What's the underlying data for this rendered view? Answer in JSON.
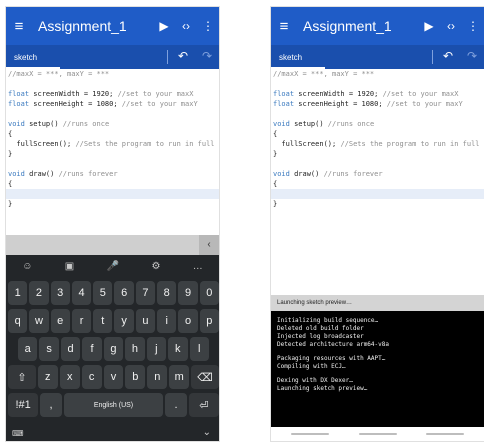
{
  "left": {
    "app_title": "Assignment_1",
    "menu_icon": "menu-icon",
    "play_icon": "play-icon",
    "code_icon": "code-icon",
    "more_icon": "more-vert-icon",
    "tab_label": "sketch",
    "undo_icon": "undo-icon",
    "redo_icon": "redo-icon",
    "code_lines": [
      "//maxX = ***, maxY = ***",
      "",
      "float screenWidth = 1920; //set to your maxX",
      "float screenHeight = 1080; //set to your maxY",
      "",
      "void setup() //runs once",
      "{",
      "  fullScreen(); //Sets the program to run in full",
      "}",
      "",
      "void draw() //runs forever",
      "{",
      "",
      "}"
    ],
    "keyboard": {
      "collapse_glyph": "‹",
      "tools": [
        "☺",
        "▣",
        "🎤",
        "⚙",
        "…"
      ],
      "number_row": [
        "1",
        "2",
        "3",
        "4",
        "5",
        "6",
        "7",
        "8",
        "9",
        "0"
      ],
      "row1": [
        "q",
        "w",
        "e",
        "r",
        "t",
        "y",
        "u",
        "i",
        "o",
        "p"
      ],
      "row2": [
        "a",
        "s",
        "d",
        "f",
        "g",
        "h",
        "j",
        "k",
        "l"
      ],
      "row3": [
        "⇧",
        "z",
        "x",
        "c",
        "v",
        "b",
        "n",
        "m",
        "⌫"
      ],
      "bottom_row": [
        "!#1",
        ",",
        "English (US)",
        ".",
        "⏎"
      ],
      "kbd_icon_glyph": "⌨",
      "hide_glyph": "⌄"
    }
  },
  "right": {
    "app_title": "Assignment_1",
    "tab_label": "sketch",
    "code_lines": [
      "//maxX = ***, maxY = ***",
      "",
      "float screenWidth = 1920; //set to your maxX",
      "float screenHeight = 1080; //set to your maxY",
      "",
      "void setup() //runs once",
      "{",
      "  fullScreen(); //Sets the program to run in full",
      "}",
      "",
      "void draw() //runs forever",
      "{",
      "",
      "}"
    ],
    "console_title": "Launching sketch preview…",
    "console_lines": [
      "Initializing build sequence…",
      "Deleted old build folder",
      "Injected log broadcaster",
      "Detected architecture arm64-v8a",
      "",
      "Packaging resources with AAPT…",
      "Compiling with ECJ…",
      "",
      "Dexing with DX Dexer…",
      "Launching sketch preview…"
    ]
  },
  "colors": {
    "appbar": "#1f5cc7",
    "tabbar": "#1a4fad",
    "keyboard_bg": "#232629",
    "key_bg": "#3c4043",
    "console_bg": "#000000"
  }
}
